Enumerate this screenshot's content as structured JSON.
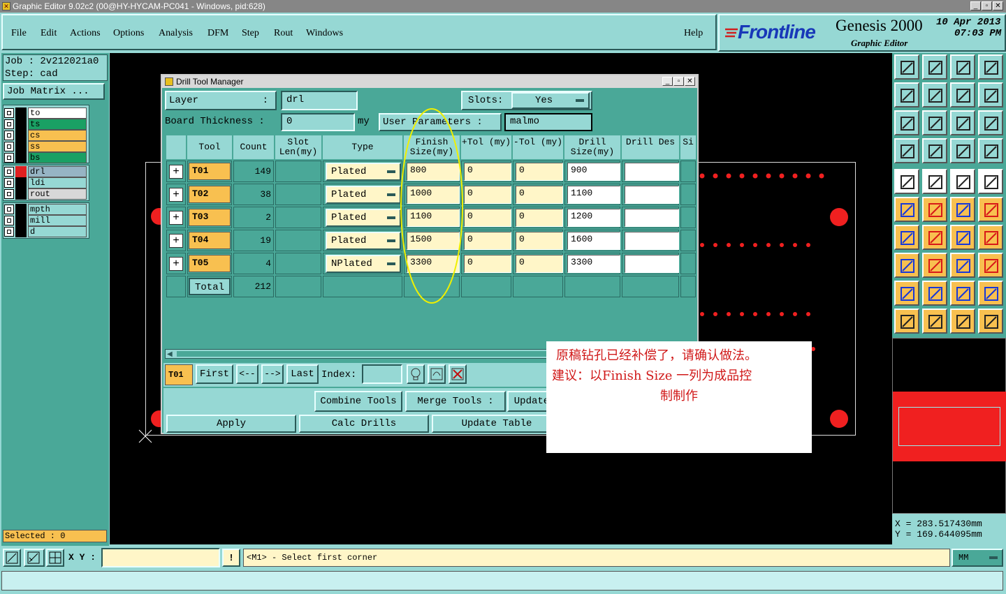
{
  "window": {
    "title": "Graphic Editor 9.02c2 (00@HY-HYCAM-PC041 - Windows, pid:628)"
  },
  "menu": [
    "File",
    "Edit",
    "Actions",
    "Options",
    "Analysis",
    "DFM",
    "Step",
    "Rout",
    "Windows"
  ],
  "help": "Help",
  "brand": {
    "logo": "Frontline",
    "product": "Genesis 2000",
    "subtitle": "Graphic Editor",
    "date": "10 Apr 2013",
    "time": "07:03 PM"
  },
  "job": {
    "job_label": "Job : 2v212021a0",
    "step_label": "Step: cad",
    "matrix_button": "Job Matrix ..."
  },
  "layers": [
    {
      "name": "to",
      "color": "#ffffff",
      "swatch": "#000000"
    },
    {
      "name": "ts",
      "color": "#1aa064",
      "swatch": "#000000"
    },
    {
      "name": "cs",
      "color": "#f8c050",
      "swatch": "#000000"
    },
    {
      "name": "ss",
      "color": "#f8c050",
      "swatch": "#000000"
    },
    {
      "name": "bs",
      "color": "#1aa064",
      "swatch": "#000000"
    },
    {
      "name": "drl",
      "color": "#96b4c4",
      "swatch": "#e02020"
    },
    {
      "name": "ldi",
      "color": "#96d8d4",
      "swatch": "#000000"
    },
    {
      "name": "rout",
      "color": "#d8d8d8",
      "swatch": "#000000"
    },
    {
      "name": "mpth",
      "color": "#96d8d4",
      "swatch": "#000000"
    },
    {
      "name": "mill",
      "color": "#96d8d4",
      "swatch": "#000000"
    },
    {
      "name": "d",
      "color": "#96d8d4",
      "swatch": "#000000"
    }
  ],
  "selected": "Selected : 0",
  "dialog": {
    "title": "Drill Tool Manager",
    "layer_label": "Layer",
    "layer_value": "drl",
    "slots_label": "Slots:",
    "slots_value": "Yes",
    "board_thickness_label": "Board Thickness :",
    "board_thickness_value": "0",
    "thickness_unit": "my",
    "user_params_label": "User Parameters :",
    "user_params_value": "malmo",
    "columns": [
      "Tool",
      "Count",
      "Slot Len(my)",
      "Type",
      "Finish Size(my)",
      "+Tol (my)",
      "-Tol (my)",
      "Drill Size(my)",
      "Drill Des",
      "Si"
    ],
    "rows": [
      {
        "tool": "T01",
        "count": "149",
        "type": "Plated",
        "finish": "800",
        "ptol": "0",
        "ntol": "0",
        "drill": "900",
        "des": ""
      },
      {
        "tool": "T02",
        "count": "38",
        "type": "Plated",
        "finish": "1000",
        "ptol": "0",
        "ntol": "0",
        "drill": "1100",
        "des": ""
      },
      {
        "tool": "T03",
        "count": "2",
        "type": "Plated",
        "finish": "1100",
        "ptol": "0",
        "ntol": "0",
        "drill": "1200",
        "des": ""
      },
      {
        "tool": "T04",
        "count": "19",
        "type": "Plated",
        "finish": "1500",
        "ptol": "0",
        "ntol": "0",
        "drill": "1600",
        "des": ""
      },
      {
        "tool": "T05",
        "count": "4",
        "type": "NPlated",
        "finish": "3300",
        "ptol": "0",
        "ntol": "0",
        "drill": "3300",
        "des": ""
      }
    ],
    "total_label": "Total",
    "total_count": "212",
    "current_tool": "T01",
    "nav": {
      "first": "First",
      "prev": "<--",
      "next": "-->",
      "last": "Last",
      "index": "Index:"
    },
    "combine": "Combine Tools",
    "merge": "Merge Tools :",
    "update": "Update",
    "apply": "Apply",
    "calc": "Calc Drills",
    "update_table": "Update Table"
  },
  "note": {
    "line1": "原稿钻孔已经补偿了，请确认做法。",
    "line2": "建议：以Finish Size 一列为成品控",
    "line3": "制制作"
  },
  "coords": {
    "x": "X = 283.517430mm",
    "y": "Y = 169.644095mm"
  },
  "status": {
    "xy_label": "X Y :",
    "message": "<M1> - Select first corner",
    "units": "MM"
  }
}
